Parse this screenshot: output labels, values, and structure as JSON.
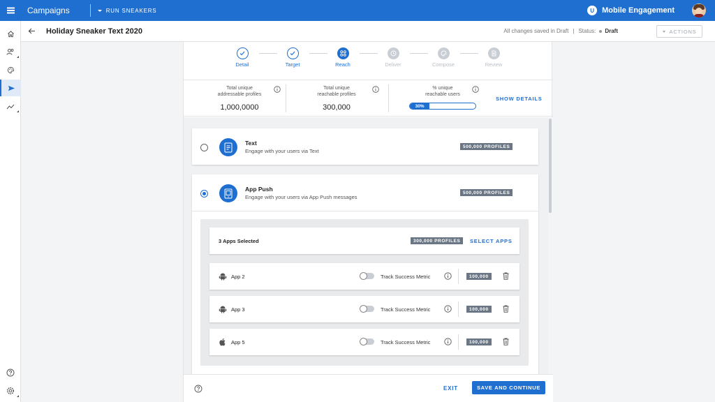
{
  "topbar": {
    "app_title": "Campaigns",
    "campaign_selector": "RUN SNEAKERS",
    "product_name": "Mobile Engagement",
    "product_logo": "U"
  },
  "rail": {
    "icons": [
      "home-icon",
      "users-icon",
      "palette-icon",
      "send-icon",
      "analytics-icon",
      "help-icon",
      "settings-icon"
    ],
    "active": "send-icon"
  },
  "header": {
    "title": "Holiday Sneaker Text 2020",
    "saved_text": "All changes saved in Draft",
    "separator": "|",
    "status_label": "Status:",
    "status_value": "Draft",
    "actions_label": "ACTIONS"
  },
  "stepper": {
    "steps": [
      {
        "label": "Detail",
        "state": "done"
      },
      {
        "label": "Target",
        "state": "done"
      },
      {
        "label": "Reach",
        "state": "current"
      },
      {
        "label": "Deliver",
        "state": "pending"
      },
      {
        "label": "Compose",
        "state": "pending"
      },
      {
        "label": "Review",
        "state": "pending"
      }
    ]
  },
  "stats": {
    "addressable": {
      "caption_1": "Total unique",
      "caption_2": "addressable profiles",
      "value": "1,000,0000"
    },
    "reachable": {
      "caption_1": "Total unique",
      "caption_2": "reachable profiles",
      "value": "300,000"
    },
    "percent": {
      "caption_1": "% unique",
      "caption_2": "reachable users",
      "value": "30%",
      "fraction": 0.3
    },
    "show_details": "SHOW DETAILS"
  },
  "channels": {
    "text": {
      "title": "Text",
      "description": "Engage with your users via Text",
      "profiles": "500,000 PROFILES",
      "selected": false
    },
    "app_push": {
      "title": "App Push",
      "description": "Engage with your users via App Push messages",
      "profiles": "500,000 PROFILES",
      "selected": true,
      "apps_selected": "3 Apps Selected",
      "apps_profiles": "300,000 PROFILES",
      "select_apps": "SELECT APPS",
      "apps": [
        {
          "name": "App 2",
          "platform": "android-icon",
          "metric_label": "Track Success Metric",
          "count": "100,000",
          "tracking": false
        },
        {
          "name": "App 3",
          "platform": "android-icon",
          "metric_label": "Track Success Metric",
          "count": "100,000",
          "tracking": false
        },
        {
          "name": "App 5",
          "platform": "apple-icon",
          "metric_label": "Track Success Metric",
          "count": "100,000",
          "tracking": false
        }
      ]
    }
  },
  "footer": {
    "exit_label": "EXIT",
    "save_label": "SAVE AND CONTINUE"
  },
  "colors": {
    "brand": "#1f6fd1",
    "badge": "#6b7685",
    "pending": "#c9ced5"
  }
}
